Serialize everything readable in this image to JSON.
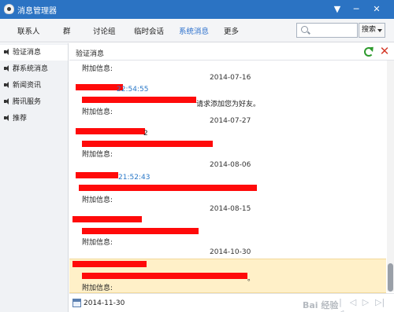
{
  "window": {
    "title": "消息管理器",
    "minimize_glyph": "▼",
    "maximize_glyph": "─",
    "close_glyph": "✕"
  },
  "nav": {
    "tabs": [
      "联系人",
      "群",
      "讨论组",
      "临时会话",
      "系统消息",
      "更多"
    ],
    "active_tab": "系统消息",
    "search_placeholder": "",
    "search_button": "搜索"
  },
  "sidebar": {
    "items": [
      "验证消息",
      "群系统消息",
      "新闻资讯",
      "腾讯服务",
      "推荐"
    ],
    "active_item": "验证消息"
  },
  "content": {
    "header_label": "验证消息",
    "refresh_icon": "refresh-icon",
    "delete_icon": "delete-icon",
    "extra_info_label": "附加信息:",
    "dates": [
      "2014-07-16",
      "2014-07-27",
      "2014-08-06",
      "2014-08-15",
      "2014-10-30"
    ],
    "times": [
      "22:54:55",
      "21:52:43"
    ],
    "request_text": "请求添加您为好友。",
    "partial_char_1": "2",
    "partial_char_2": "。"
  },
  "footer": {
    "date": "2014-11-30",
    "pager": {
      "first": "|◁",
      "prev": "◁",
      "next": "▷",
      "last": "▷|"
    },
    "watermark_text": "Bai 经验"
  },
  "colors": {
    "titlebar": "#2b73c3",
    "accent": "#2a6fcc",
    "redaction": "#ff0a0a",
    "highlight": "#fff0c8"
  }
}
